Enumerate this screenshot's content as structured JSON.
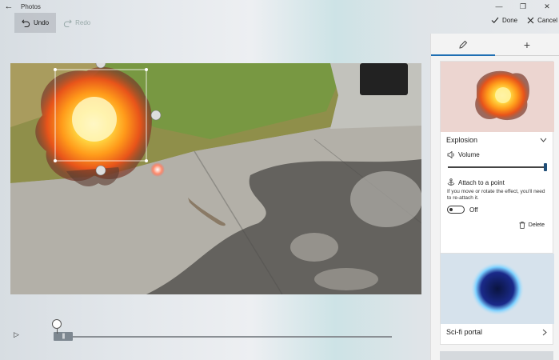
{
  "window": {
    "title": "Photos",
    "back_glyph": "←",
    "min_glyph": "—",
    "restore_glyph": "❐",
    "close_glyph": "✕"
  },
  "toolbar": {
    "undo_label": "Undo",
    "redo_label": "Redo"
  },
  "actions": {
    "done_label": "Done",
    "cancel_label": "Cancel"
  },
  "timeline": {
    "play_glyph": "▷",
    "handle_glyph": "|||"
  },
  "panel": {
    "tabs": [
      {
        "icon": "pencil-icon",
        "active": true
      },
      {
        "icon": "plus-icon",
        "glyph": "+",
        "active": false
      }
    ],
    "effects": [
      {
        "name": "Explosion",
        "volume_label": "Volume",
        "volume_level": 1.0,
        "attach_label": "Attach to a point",
        "attach_note": "If you move or rotate the effect, you'll need to re-attach it.",
        "toggle_state": "Off",
        "delete_label": "Delete"
      },
      {
        "name": "Sci-fi portal"
      }
    ]
  },
  "colors": {
    "accent": "#1f6fb3",
    "panel_bg": "#f3f3f3"
  }
}
